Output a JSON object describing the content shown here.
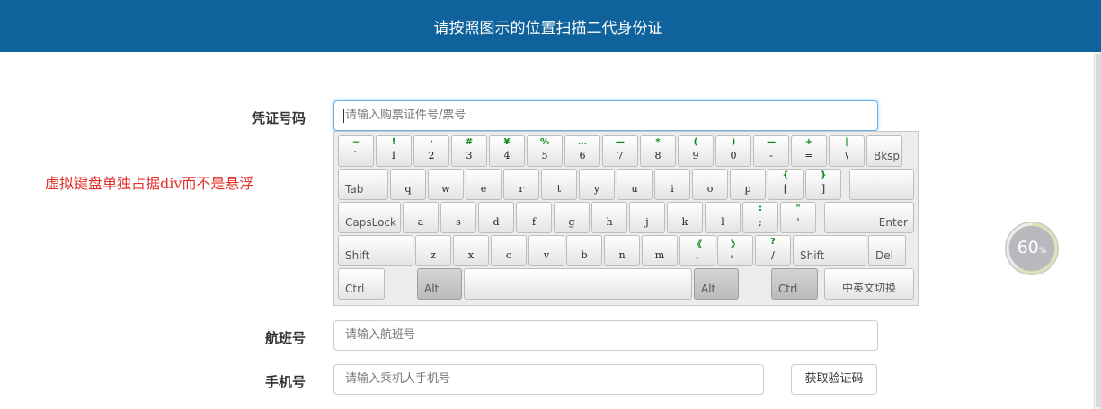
{
  "header": {
    "title": "请按照图示的位置扫描二代身份证"
  },
  "note": "虚拟键盘单独占据div而不是悬浮",
  "form": {
    "credential_label": "凭证号码",
    "credential_placeholder": "请输入购票证件号/票号",
    "flight_label": "航班号",
    "flight_placeholder": "请输入航班号",
    "phone_label": "手机号",
    "phone_placeholder": "请输入乘机人手机号",
    "get_code_button": "获取验证码"
  },
  "keyboard": {
    "row1": [
      {
        "main": "`",
        "sub": "~"
      },
      {
        "main": "1",
        "sub": "!"
      },
      {
        "main": "2",
        "sub": "·"
      },
      {
        "main": "3",
        "sub": "#"
      },
      {
        "main": "4",
        "sub": "¥"
      },
      {
        "main": "5",
        "sub": "%"
      },
      {
        "main": "6",
        "sub": "…"
      },
      {
        "main": "7",
        "sub": "—"
      },
      {
        "main": "8",
        "sub": "*"
      },
      {
        "main": "9",
        "sub": "("
      },
      {
        "main": "0",
        "sub": ")"
      },
      {
        "main": "-",
        "sub": "—"
      },
      {
        "main": "=",
        "sub": "+"
      },
      {
        "main": "\\",
        "sub": "|"
      }
    ],
    "row2": [
      {
        "main": "q",
        "sub": ""
      },
      {
        "main": "w",
        "sub": ""
      },
      {
        "main": "e",
        "sub": ""
      },
      {
        "main": "r",
        "sub": ""
      },
      {
        "main": "t",
        "sub": ""
      },
      {
        "main": "y",
        "sub": ""
      },
      {
        "main": "u",
        "sub": ""
      },
      {
        "main": "i",
        "sub": ""
      },
      {
        "main": "o",
        "sub": ""
      },
      {
        "main": "p",
        "sub": ""
      },
      {
        "main": "[",
        "sub": "{"
      },
      {
        "main": "]",
        "sub": "}"
      }
    ],
    "row3": [
      {
        "main": "a",
        "sub": ""
      },
      {
        "main": "s",
        "sub": ""
      },
      {
        "main": "d",
        "sub": ""
      },
      {
        "main": "f",
        "sub": ""
      },
      {
        "main": "g",
        "sub": ""
      },
      {
        "main": "h",
        "sub": ""
      },
      {
        "main": "j",
        "sub": ""
      },
      {
        "main": "k",
        "sub": ""
      },
      {
        "main": "l",
        "sub": ""
      },
      {
        "main": ";",
        "sub": ":"
      },
      {
        "main": "'",
        "sub": "\""
      }
    ],
    "row4": [
      {
        "main": "z",
        "sub": ""
      },
      {
        "main": "x",
        "sub": ""
      },
      {
        "main": "c",
        "sub": ""
      },
      {
        "main": "v",
        "sub": ""
      },
      {
        "main": "b",
        "sub": ""
      },
      {
        "main": "n",
        "sub": ""
      },
      {
        "main": "m",
        "sub": ""
      },
      {
        "main": ",",
        "sub": "《"
      },
      {
        "main": "。",
        "sub": "》"
      },
      {
        "main": "/",
        "sub": "?"
      }
    ],
    "backspace": "Bksp",
    "tab": "Tab",
    "capslock": "CapsLock",
    "enter": "Enter",
    "shift_left": "Shift",
    "shift_right": "Shift",
    "del": "Del",
    "ctrl_left": "Ctrl",
    "alt_left": "Alt",
    "alt_right": "Alt",
    "ctrl_right": "Ctrl",
    "ime_switch": "中英文切换"
  },
  "progress": {
    "value": "60",
    "unit": "%",
    "fraction": 0.6
  }
}
